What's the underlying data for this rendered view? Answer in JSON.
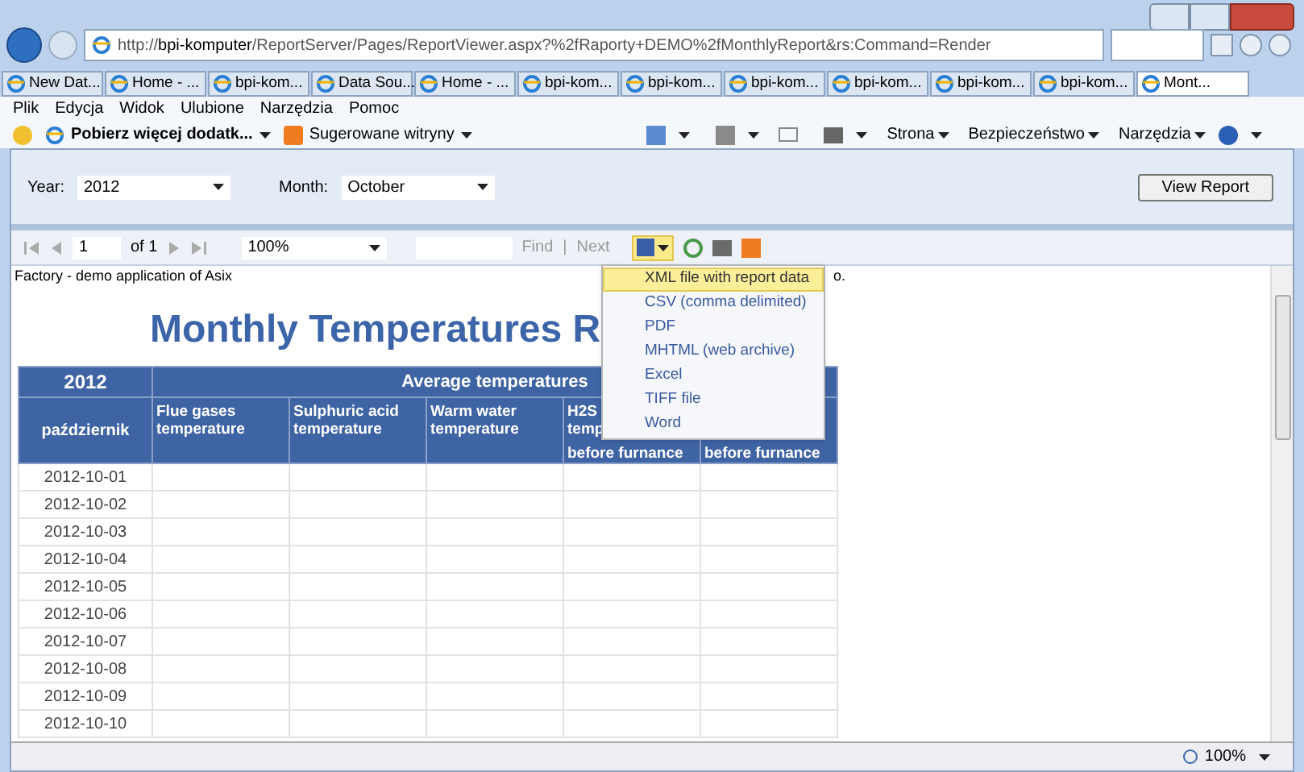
{
  "browser": {
    "address": [
      {
        "text": "http://",
        "kind": "plain"
      },
      {
        "text": "bpi-komputer",
        "kind": "host"
      },
      {
        "text": "/ReportServer/Pages/ReportViewer.aspx?%2fRaporty+DEMO%2fMonthlyReport&rs:Command=Render",
        "kind": "plain"
      }
    ],
    "tabs": [
      {
        "label": "New Dat...",
        "selected": false
      },
      {
        "label": "Home - ...",
        "selected": false
      },
      {
        "label": "bpi-kom...",
        "selected": false
      },
      {
        "label": "Data Sou...",
        "selected": false
      },
      {
        "label": "Home - ...",
        "selected": false
      },
      {
        "label": "bpi-kom...",
        "selected": false
      },
      {
        "label": "bpi-kom...",
        "selected": false
      },
      {
        "label": "bpi-kom...",
        "selected": false
      },
      {
        "label": "bpi-kom...",
        "selected": false
      },
      {
        "label": "bpi-kom...",
        "selected": false
      },
      {
        "label": "bpi-kom...",
        "selected": false
      },
      {
        "label": "Mont...",
        "selected": true
      }
    ],
    "menu": [
      "Plik",
      "Edycja",
      "Widok",
      "Ulubione",
      "Narzędzia",
      "Pomoc"
    ],
    "favorites": [
      {
        "label": "Pobierz więcej dodatk...",
        "kind": "ie"
      },
      {
        "label": "Sugerowane witryny",
        "kind": "suggest"
      }
    ],
    "commands": [
      "Strona",
      "Bezpieczeństwo",
      "Narzędzia"
    ],
    "zoom": "100%"
  },
  "parameters": {
    "year_label": "Year:",
    "year": "2012",
    "month_label": "Month:",
    "month": "October",
    "view_button": "View Report"
  },
  "toolbar": {
    "page": "1",
    "of": "of 1",
    "zoom": "100%",
    "find": "Find",
    "separator": "|",
    "next": "Next"
  },
  "export_menu": [
    {
      "label": "XML file with report data",
      "selected": true
    },
    {
      "label": "CSV (comma delimited)",
      "selected": false
    },
    {
      "label": "PDF",
      "selected": false
    },
    {
      "label": "MHTML (web archive)",
      "selected": false
    },
    {
      "label": "Excel",
      "selected": false
    },
    {
      "label": "TIFF file",
      "selected": false
    },
    {
      "label": "Word",
      "selected": false
    }
  ],
  "report": {
    "description": "Factory - demo application of Asix",
    "description_tail": "o.",
    "title": "Monthly Temperatures R",
    "year": "2012",
    "group": "Average temperatures",
    "month": "październik",
    "columns": [
      [
        "Flue gases",
        "temperature"
      ],
      [
        "Sulphuric acid",
        "temperature"
      ],
      [
        "Warm water",
        "temperature"
      ],
      [
        "H2S",
        "temp",
        "before furnance"
      ],
      [
        "",
        "",
        "before furnance"
      ]
    ],
    "rows": [
      "2012-10-01",
      "2012-10-02",
      "2012-10-03",
      "2012-10-04",
      "2012-10-05",
      "2012-10-06",
      "2012-10-07",
      "2012-10-08",
      "2012-10-09",
      "2012-10-10"
    ]
  }
}
